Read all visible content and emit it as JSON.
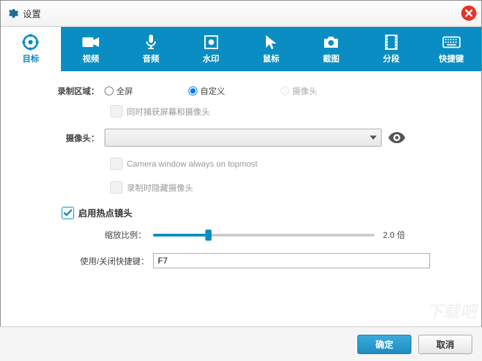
{
  "window": {
    "title": "设置"
  },
  "tabs": {
    "target": "目标",
    "video": "视频",
    "audio": "音频",
    "watermark": "水印",
    "mouse": "鼠标",
    "screenshot": "截图",
    "segment": "分段",
    "hotkey": "快捷键"
  },
  "recArea": {
    "label": "录制区域：",
    "fullscreen": "全屏",
    "custom": "自定义",
    "camera": "摄像头",
    "selected": "custom"
  },
  "captureBoth": "同时捕获屏幕和摄像头",
  "camera": {
    "label": "摄像头："
  },
  "cameraOnTop": "Camera window always on topmost",
  "hideCameraWhenRec": "录制时隐藏摄像头",
  "zoomLens": {
    "enable": "启用热点镜头",
    "ratioLabel": "缩放比例：",
    "ratioValue": "2.0 倍",
    "hotkeyLabel": "使用/关闭快捷键：",
    "hotkeyValue": "F7"
  },
  "buttons": {
    "ok": "确定",
    "cancel": "取消"
  }
}
